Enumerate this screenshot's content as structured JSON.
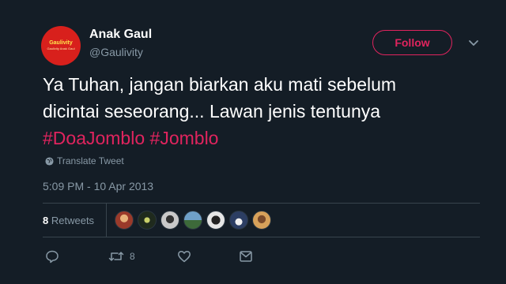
{
  "user": {
    "name": "Anak Gaul",
    "handle": "@Gaulivity",
    "avatar_brand": "Gaulivity",
    "avatar_tagline": "Gaulivity Anak Gaul"
  },
  "follow_label": "Follow",
  "tweet": {
    "text_line1": "Ya Tuhan, jangan biarkan aku mati sebelum",
    "text_line2": "dicintai seseorang... Lawan jenis tentunya",
    "hashtags": [
      "#DoaJomblo",
      "#Jomblo"
    ]
  },
  "translate_label": "Translate Tweet",
  "timestamp": "5:09 PM - 10 Apr 2013",
  "stats": {
    "retweet_count": "8",
    "retweet_label": "Retweets"
  },
  "retweeter_avatars": [
    {
      "color": "#9a3a2a"
    },
    {
      "color": "#1f2a1d"
    },
    {
      "color": "#c9c9c9"
    },
    {
      "color": "#4f7aa0"
    },
    {
      "color": "#e6e6e6"
    },
    {
      "color": "#2c3e63"
    },
    {
      "color": "#d7a15a"
    }
  ],
  "actions": {
    "reply_icon": "reply-icon",
    "retweet_icon": "retweet-icon",
    "retweet_count": "8",
    "like_icon": "heart-icon",
    "message_icon": "message-icon"
  },
  "colors": {
    "background": "#141d26",
    "accent": "#e0245e",
    "muted": "#8899a6",
    "divider": "#38444d"
  }
}
